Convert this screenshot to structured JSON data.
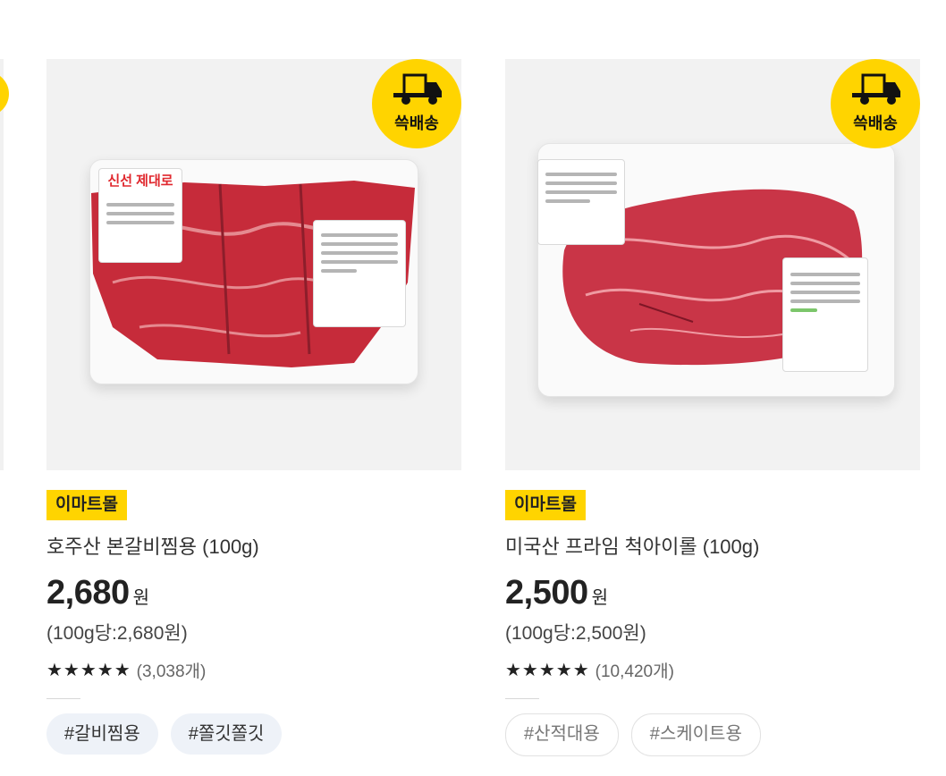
{
  "products": [
    {
      "mall": "이마트몰",
      "name": "호주산 본갈비찜용 (100g)",
      "price": "2,680",
      "currency": "원",
      "unit_price": "(100g당:2,680원)",
      "stars": "★★★★★",
      "rating_display": 4.5,
      "review_count": "(3,038개)",
      "hashtags": [
        "#갈비찜용",
        "#쫄깃쫄깃"
      ],
      "hashtag_style": "filled",
      "delivery_badge": "쓱배송",
      "sticker_text": "신선 제대로"
    },
    {
      "mall": "이마트몰",
      "name": "미국산 프라임 척아이롤 (100g)",
      "price": "2,500",
      "currency": "원",
      "unit_price": "(100g당:2,500원)",
      "stars": "★★★★★",
      "rating_display": 5,
      "review_count": "(10,420개)",
      "hashtags": [
        "#산적대용",
        "#스케이트용"
      ],
      "hashtag_style": "outlined",
      "delivery_badge": "쓱배송"
    }
  ],
  "colors": {
    "accent_yellow": "#ffd400",
    "meat_red": "#c62b3a",
    "hashtag_bg": "#eef2f8"
  }
}
